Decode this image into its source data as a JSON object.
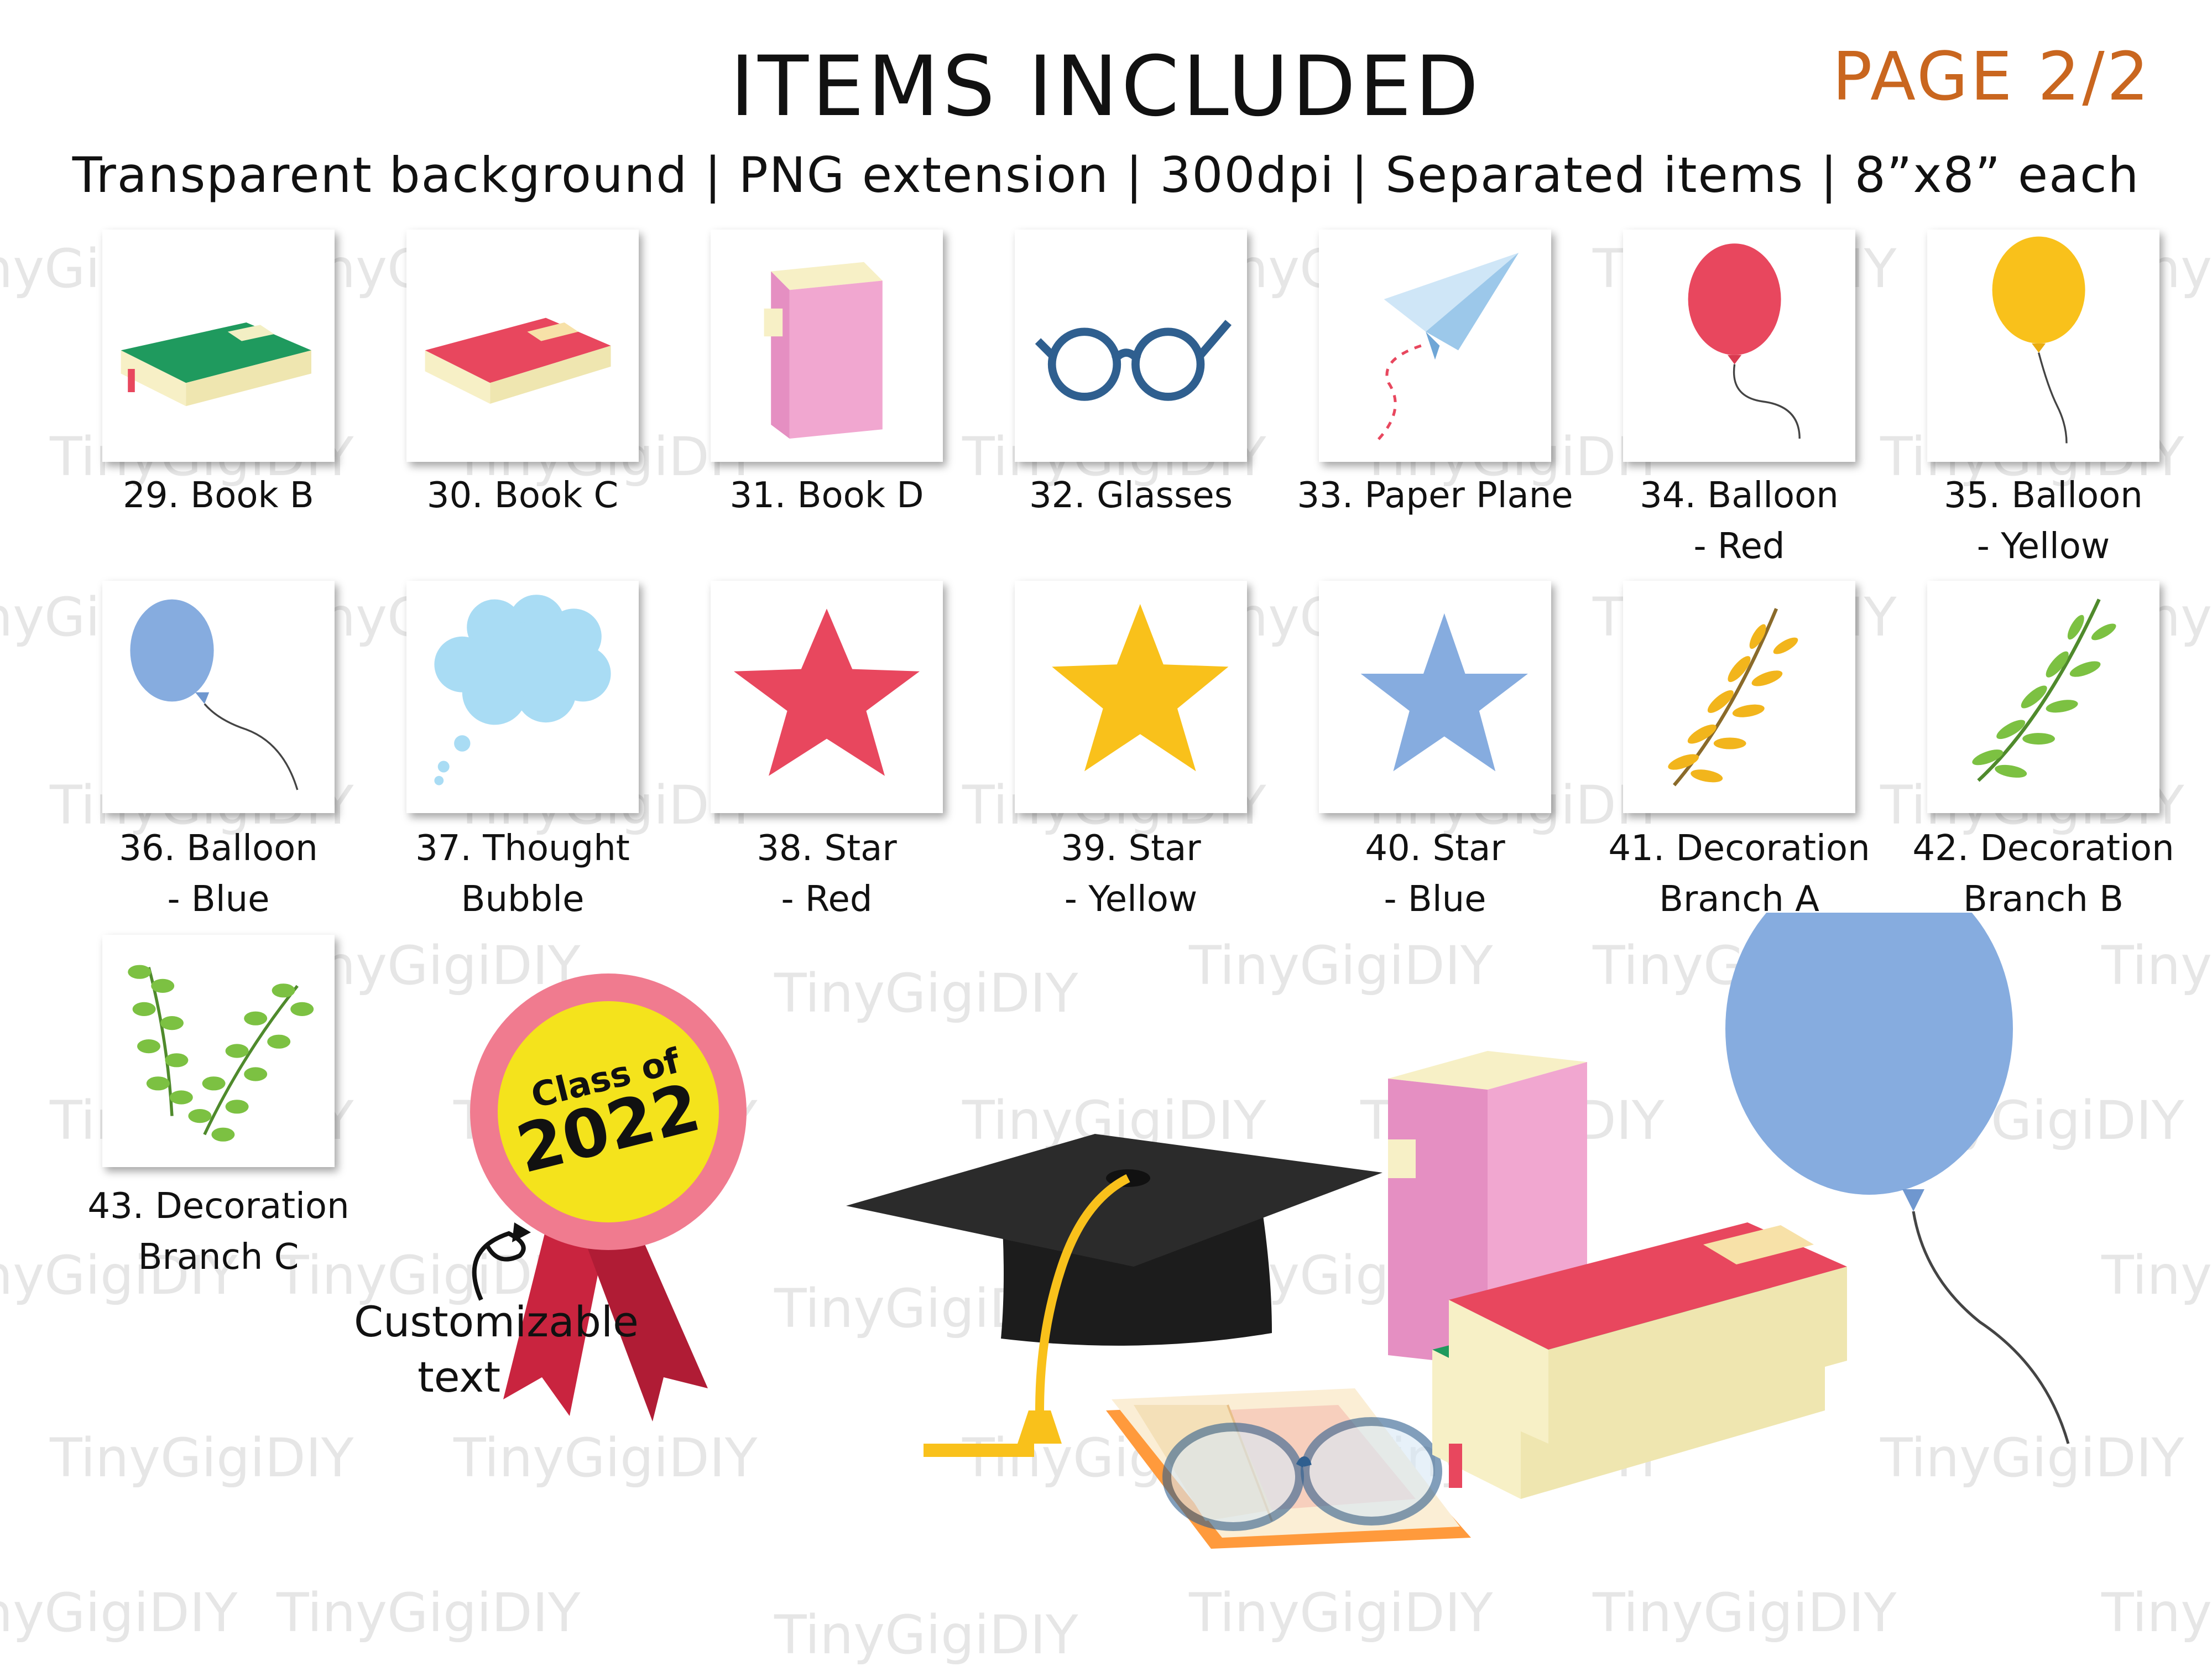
{
  "header": {
    "title": "ITEMS INCLUDED",
    "page": "PAGE 2/2",
    "subtitle": "Transparent background | PNG extension | 300dpi | Separated items | 8”x8” each"
  },
  "watermark": "TinyGigiDIY",
  "items": [
    {
      "line1": "29. Book B",
      "line2": "",
      "icon": "green-book-icon"
    },
    {
      "line1": "30. Book C",
      "line2": "",
      "icon": "red-book-icon"
    },
    {
      "line1": "31. Book D",
      "line2": "",
      "icon": "pink-book-icon"
    },
    {
      "line1": "32. Glasses",
      "line2": "",
      "icon": "glasses-icon"
    },
    {
      "line1": "33. Paper Plane",
      "line2": "",
      "icon": "paper-plane-icon"
    },
    {
      "line1": "34. Balloon",
      "line2": "- Red",
      "icon": "red-balloon-icon"
    },
    {
      "line1": "35. Balloon",
      "line2": "- Yellow",
      "icon": "yellow-balloon-icon"
    },
    {
      "line1": "36. Balloon",
      "line2": "- Blue",
      "icon": "blue-balloon-icon"
    },
    {
      "line1": "37. Thought",
      "line2": "Bubble",
      "icon": "thought-bubble-icon"
    },
    {
      "line1": "38. Star",
      "line2": "- Red",
      "icon": "red-star-icon"
    },
    {
      "line1": "39. Star",
      "line2": "- Yellow",
      "icon": "yellow-star-icon"
    },
    {
      "line1": "40. Star",
      "line2": "- Blue",
      "icon": "blue-star-icon"
    },
    {
      "line1": "41. Decoration",
      "line2": "Branch A",
      "icon": "yellow-branch-icon"
    },
    {
      "line1": "42. Decoration",
      "line2": "Branch B",
      "icon": "green-branch-icon"
    },
    {
      "line1": "43. Decoration",
      "line2": "Branch C",
      "icon": "green-branches-icon"
    }
  ],
  "hero": {
    "badge_line1": "Class of",
    "badge_line2": "2022",
    "note_line1": "Customizable",
    "note_line2": "text"
  },
  "colors": {
    "accent": "#c9661f",
    "green_book": "#1f9a5e",
    "red": "#e8475e",
    "pink": "#f1a7d0",
    "yellow": "#f9c11b",
    "blue": "#86acdf",
    "frame": "#2f5f8f"
  }
}
